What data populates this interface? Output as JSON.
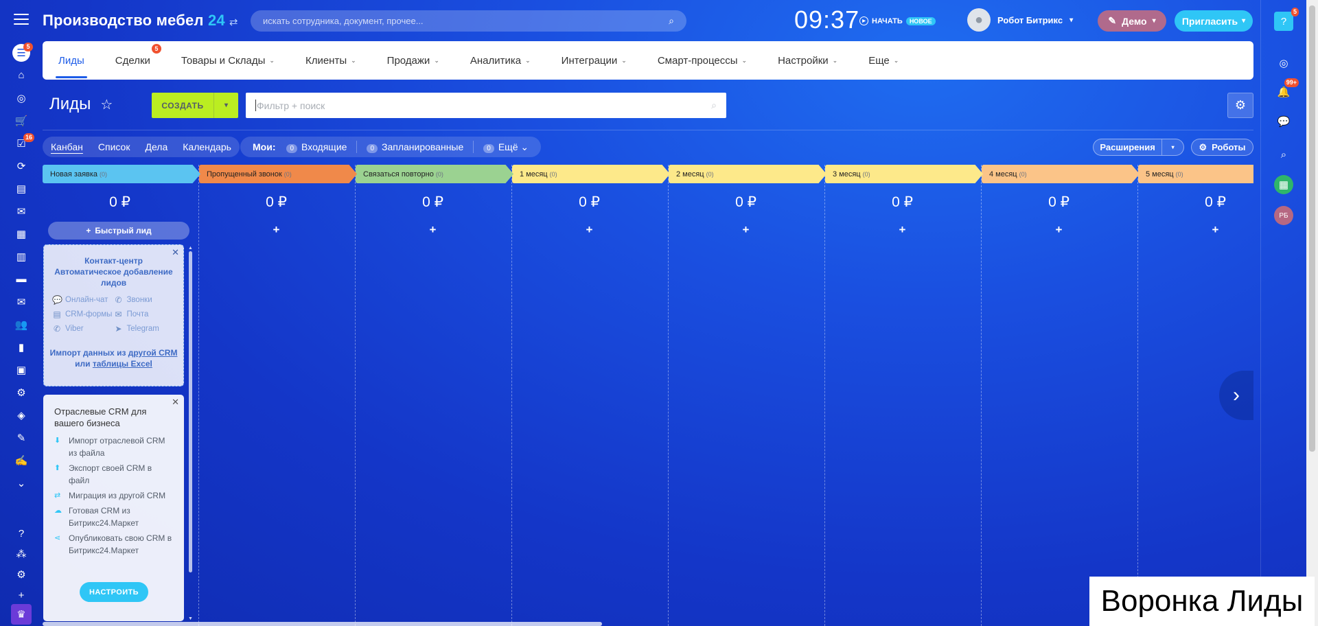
{
  "portal": {
    "title": "Производство мебел",
    "num": "24",
    "swap": "⇄"
  },
  "search": {
    "placeholder": "искать сотрудника, документ, прочее...",
    "icon": "search-icon"
  },
  "clock": "09:37",
  "start_work": {
    "label": "НАЧАТЬ",
    "badge": "НОВОЕ"
  },
  "user": {
    "name": "Робот Битрикс",
    "caret": "▾"
  },
  "demo": {
    "label": "Демо",
    "caret": "▾"
  },
  "invite": {
    "label": "Пригласить",
    "caret": "▾"
  },
  "left_rail": {
    "items": [
      {
        "glyph": "☰",
        "badge": "5",
        "icon": "crm-funnel-icon"
      },
      {
        "glyph": "⌂",
        "badge": "",
        "icon": "home-icon"
      },
      {
        "glyph": "◎",
        "badge": "",
        "icon": "target-icon"
      },
      {
        "glyph": "🛒",
        "badge": "",
        "icon": "cart-icon"
      },
      {
        "glyph": "☑",
        "badge": "16",
        "icon": "tasks-icon"
      },
      {
        "glyph": "⟳",
        "badge": "",
        "icon": "automation-icon"
      },
      {
        "glyph": "▤",
        "badge": "",
        "icon": "feed-icon"
      },
      {
        "glyph": "✉",
        "badge": "",
        "icon": "chat-icon"
      },
      {
        "glyph": "▦",
        "badge": "",
        "icon": "calendar-icon"
      },
      {
        "glyph": "▥",
        "badge": "",
        "icon": "docs-icon"
      },
      {
        "glyph": "▬",
        "badge": "",
        "icon": "drive-icon"
      },
      {
        "glyph": "✉",
        "badge": "",
        "icon": "mail-icon"
      },
      {
        "glyph": "👥",
        "badge": "",
        "icon": "employees-icon"
      },
      {
        "glyph": "▮",
        "badge": "",
        "icon": "analytics-icon"
      },
      {
        "glyph": "▣",
        "badge": "",
        "icon": "store-icon"
      },
      {
        "glyph": "⚙",
        "badge": "",
        "icon": "robot-icon"
      },
      {
        "glyph": "◈",
        "badge": "",
        "icon": "inventory-icon"
      },
      {
        "glyph": "✎",
        "badge": "",
        "icon": "sign-icon"
      },
      {
        "glyph": "✍",
        "badge": "",
        "icon": "pen-icon"
      },
      {
        "glyph": "⌄",
        "badge": "",
        "icon": "more-icon"
      }
    ],
    "bottom": [
      {
        "glyph": "?",
        "icon": "help-icon"
      },
      {
        "glyph": "⁂",
        "icon": "sitemap-icon"
      },
      {
        "glyph": "⚙",
        "icon": "settings-icon"
      },
      {
        "glyph": "+",
        "icon": "add-icon"
      }
    ],
    "crown": "♛"
  },
  "topnav": {
    "items": [
      {
        "label": "Лиды",
        "caret": "",
        "badge": ""
      },
      {
        "label": "Сделки",
        "caret": "",
        "badge": "5"
      },
      {
        "label": "Товары и Склады",
        "caret": "⌄",
        "badge": ""
      },
      {
        "label": "Клиенты",
        "caret": "⌄",
        "badge": ""
      },
      {
        "label": "Продажи",
        "caret": "⌄",
        "badge": ""
      },
      {
        "label": "Аналитика",
        "caret": "⌄",
        "badge": ""
      },
      {
        "label": "Интеграции",
        "caret": "⌄",
        "badge": ""
      },
      {
        "label": "Смарт-процессы",
        "caret": "⌄",
        "badge": ""
      },
      {
        "label": "Настройки",
        "caret": "⌄",
        "badge": ""
      },
      {
        "label": "Еще",
        "caret": "⌄",
        "badge": ""
      }
    ]
  },
  "page": {
    "title": "Лиды",
    "star": "☆"
  },
  "create": {
    "label": "СОЗДАТЬ",
    "caret": "▾"
  },
  "filter": {
    "placeholder": "Фильтр + поиск"
  },
  "settings_glyph": "⚙",
  "views": [
    "Канбан",
    "Список",
    "Дела",
    "Календарь"
  ],
  "my": {
    "label": "Мои:",
    "items": [
      {
        "count": "0",
        "label": "Входящие"
      },
      {
        "count": "0",
        "label": "Запланированные"
      },
      {
        "count": "0",
        "label": "Ещё ⌄"
      }
    ]
  },
  "extensions": {
    "label": "Расширения",
    "caret": "▾"
  },
  "robots": {
    "label": "Роботы",
    "icon": "robot-icon"
  },
  "columns": [
    {
      "name": "Новая заявка",
      "count": "(0)",
      "sum": "0 ₽",
      "color": "#5bc4f1"
    },
    {
      "name": "Пропущенный звонок",
      "count": "(0)",
      "sum": "0 ₽",
      "color": "#f0894a"
    },
    {
      "name": "Связаться повторно",
      "count": "(0)",
      "sum": "0 ₽",
      "color": "#9bd291"
    },
    {
      "name": "1 месяц",
      "count": "(0)",
      "sum": "0 ₽",
      "color": "#fde98a"
    },
    {
      "name": "2 месяц",
      "count": "(0)",
      "sum": "0 ₽",
      "color": "#fde98a"
    },
    {
      "name": "3 месяц",
      "count": "(0)",
      "sum": "0 ₽",
      "color": "#fde98a"
    },
    {
      "name": "4 месяц",
      "count": "(0)",
      "sum": "0 ₽",
      "color": "#fbc488"
    },
    {
      "name": "5 месяц",
      "count": "(0)",
      "sum": "0 ₽",
      "color": "#fbc488"
    }
  ],
  "quick_lead": "Быстрый лид",
  "contact_center": {
    "title": "Контакт-центр Автоматическое добавление лидов",
    "channels": [
      {
        "label": "Онлайн-чат",
        "glyph": "💬",
        "icon": "online-chat-icon"
      },
      {
        "label": "Звонки",
        "glyph": "✆",
        "icon": "phone-icon"
      },
      {
        "label": "CRM-формы",
        "glyph": "▤",
        "icon": "crm-form-icon"
      },
      {
        "label": "Почта",
        "glyph": "✉",
        "icon": "mail-icon"
      },
      {
        "label": "Viber",
        "glyph": "✆",
        "icon": "viber-icon"
      },
      {
        "label": "Telegram",
        "glyph": "➤",
        "icon": "telegram-icon"
      }
    ],
    "import_prefix": "Импорт данных из",
    "import_link1": "другой CRM",
    "import_middle": "или",
    "import_link2": "таблицы Excel"
  },
  "industry": {
    "title": "Отраслевые CRM для вашего бизнеса",
    "items": [
      {
        "label": "Импорт отраслевой CRM из файла",
        "glyph": "⬇"
      },
      {
        "label": "Экспорт своей CRM в файл",
        "glyph": "⬆"
      },
      {
        "label": "Миграция из другой CRM",
        "glyph": "⇄"
      },
      {
        "label": "Готовая CRM из Битрикс24.Маркет",
        "glyph": "☁"
      },
      {
        "label": "Опубликовать свою CRM в Битрикс24.Маркет",
        "glyph": "⋖"
      }
    ],
    "button": "НАСТРОИТЬ"
  },
  "right_rail": [
    {
      "glyph": "?",
      "badge": "5",
      "icon": "help-icon",
      "bg": "#2fc6f6"
    },
    {
      "glyph": "◎",
      "badge": "",
      "icon": "activity-icon",
      "bg": ""
    },
    {
      "glyph": "🔔",
      "badge": "99+",
      "icon": "notifications-icon",
      "bg": ""
    },
    {
      "glyph": "💬",
      "badge": "",
      "icon": "messages-icon",
      "bg": ""
    },
    {
      "glyph": "⌕",
      "badge": "",
      "icon": "search-icon",
      "bg": ""
    },
    {
      "glyph": "▦",
      "badge": "",
      "icon": "calculator-icon",
      "bg": "#2fb56a"
    },
    {
      "glyph": "РБ",
      "badge": "",
      "icon": "user-avatar",
      "bg": "#b66882"
    }
  ],
  "caption": "Воронка Лиды"
}
